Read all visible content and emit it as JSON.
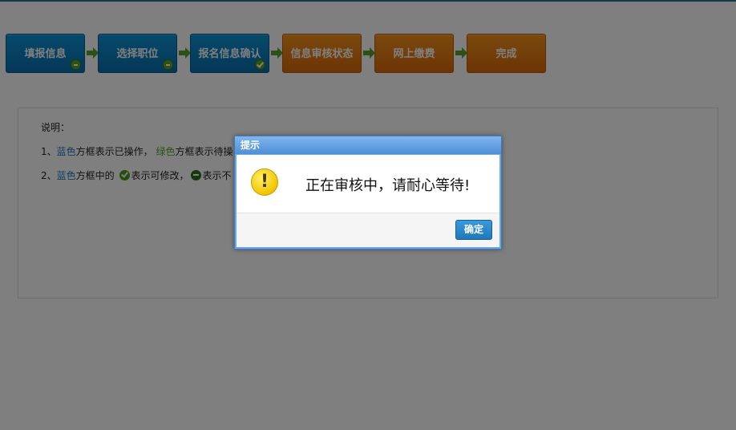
{
  "steps": [
    {
      "label": "填报信息",
      "state": "done"
    },
    {
      "label": "选择职位",
      "state": "done"
    },
    {
      "label": "报名信息确认",
      "state": "done"
    },
    {
      "label": "信息审核状态",
      "state": "pending"
    },
    {
      "label": "网上缴费",
      "state": "pending"
    },
    {
      "label": "完成",
      "state": "pending"
    }
  ],
  "info": {
    "title": "说明：",
    "line1": {
      "prefix": "1、",
      "blue_word": "蓝色",
      "mid": "方框表示已操作，",
      "green_word": "绿色",
      "suffix": "方框表示待操"
    },
    "line2": {
      "prefix": "2、",
      "blue_word": "蓝色",
      "mid": "方框中的",
      "editable": "表示可修改，",
      "locked": "表示不"
    }
  },
  "dialog": {
    "title": "提示",
    "message": "正在审核中，请耐心等待!",
    "ok_label": "确定"
  },
  "colors": {
    "blue_step": "#0a6fae",
    "orange_step": "#d96a08",
    "arrow_green": "#58a12a",
    "dialog_border": "#6aa7e8"
  }
}
